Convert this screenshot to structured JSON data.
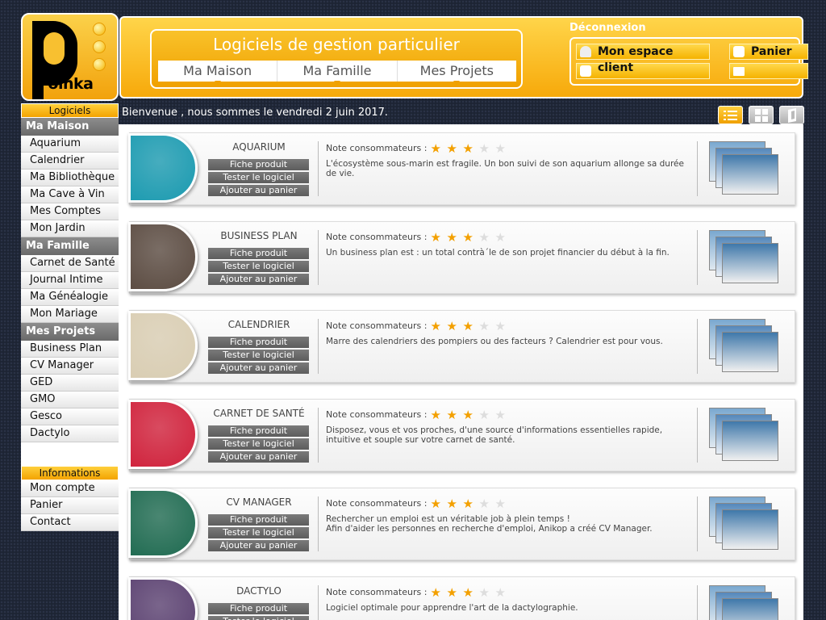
{
  "logo": {
    "word": "Poinka",
    "letter": "P"
  },
  "header": {
    "title": "Logiciels de gestion particulier",
    "nav": [
      "Ma Maison",
      "Ma Famille",
      "Mes Projets"
    ],
    "deconnexion": "Déconnexion",
    "account_label_1": "Mon espace",
    "account_label_2": "client",
    "cart_label": "Panier"
  },
  "sidebar": {
    "logiciels_header": "Logiciels",
    "sections": [
      {
        "title": "Ma Maison",
        "items": [
          "Aquarium",
          "Calendrier",
          "Ma Bibliothèque",
          "Ma Cave à Vin",
          "Mes Comptes",
          "Mon Jardin"
        ]
      },
      {
        "title": "Ma Famille",
        "items": [
          "Carnet de Santé",
          "Journal Intime",
          "Ma Généalogie",
          "Mon Mariage"
        ]
      },
      {
        "title": "Mes Projets",
        "items": [
          "Business Plan",
          "CV Manager",
          "GED",
          "GMO",
          "Gesco",
          "Dactylo"
        ]
      }
    ],
    "info_header": "Informations",
    "info_items": [
      "Mon compte",
      "Panier",
      "Contact"
    ]
  },
  "welcome": "Bienvenue , nous sommes le vendredi 2 juin 2017.",
  "product_buttons": {
    "fiche": "Fiche produit",
    "tester": "Tester le logiciel",
    "ajouter": "Ajouter au panier"
  },
  "rating_label": "Note consommateurs :",
  "products": [
    {
      "name": "AQUARIUM",
      "rating": 3,
      "max_rating": 5,
      "icon": "fish-icon",
      "color": "#1a9ab0",
      "desc": "L'écosystème sous-marin est fragile. Un bon suivi de son aquarium allonge sa durée de vie."
    },
    {
      "name": "BUSINESS PLAN",
      "rating": 3,
      "max_rating": 5,
      "icon": "euro-icon",
      "color": "#5a4a40",
      "desc": "Un business plan est : un total contrà´le de son projet financier du début à  la fin."
    },
    {
      "name": "CALENDRIER",
      "rating": 3,
      "max_rating": 5,
      "icon": "calendar-icon",
      "color": "#d9cdb2",
      "desc": "Marre des calendriers des pompiers ou des facteurs ? Calendrier est pour vous."
    },
    {
      "name": "CARNET DE SANTÉ",
      "rating": 3,
      "max_rating": 5,
      "icon": "stethoscope-icon",
      "color": "#d0203a",
      "desc": "Disposez, vous et vos proches, d'une source d'informations essentielles rapide, intuitive et souple sur votre carnet de santé."
    },
    {
      "name": "CV MANAGER",
      "rating": 3,
      "max_rating": 5,
      "icon": "cv-document-icon",
      "color": "#1e6a50",
      "desc": "Rechercher un emploi est un véritable job à  plein temps !\nAfin d'aider les personnes en recherche d'emploi, Anikop a créé CV Manager."
    },
    {
      "name": "DACTYLO",
      "rating": 3,
      "max_rating": 5,
      "icon": "keyboard-key-icon",
      "color": "#5a4070",
      "desc": "Logiciel optimale pour apprendre l'art de la dactylographie."
    }
  ]
}
